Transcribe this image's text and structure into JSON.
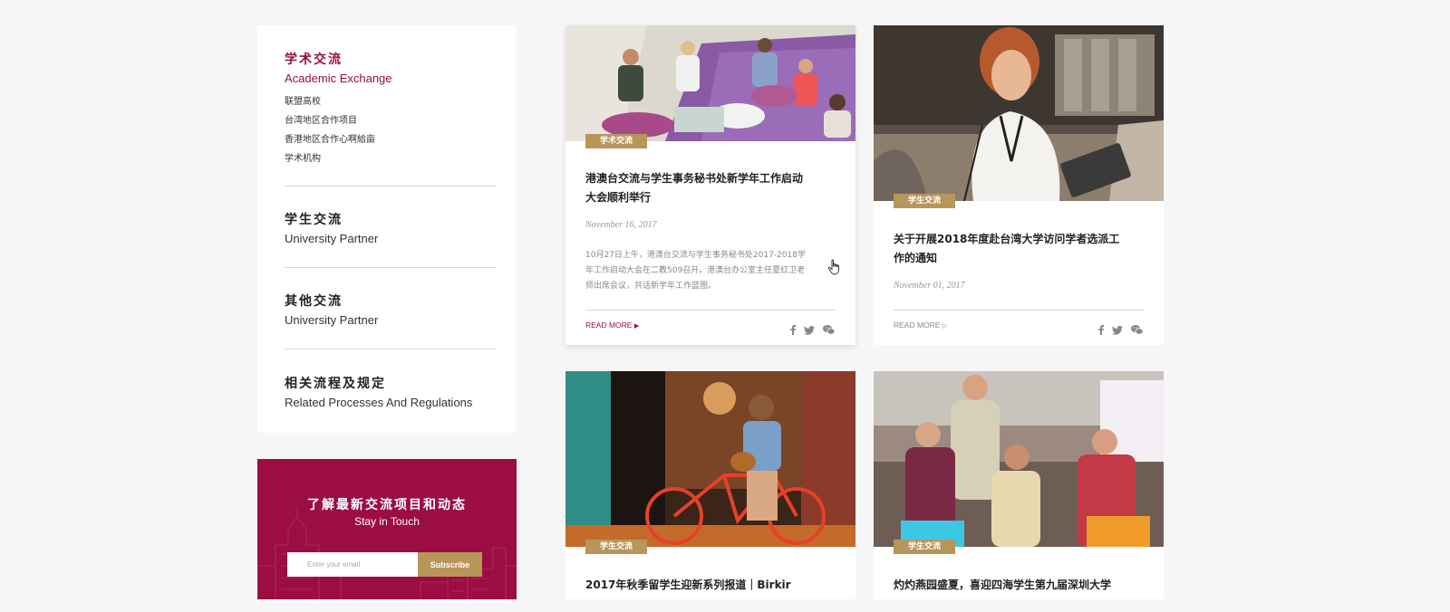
{
  "sidebar": {
    "academic": {
      "cn": "学术交流",
      "en": "Academic Exchange",
      "items": [
        "联盟高校",
        "台湾地区合作项目",
        "香港地区合作心啊給亩",
        "学术机构"
      ]
    },
    "student": {
      "cn": "学生交流",
      "en": "University Partner"
    },
    "other": {
      "cn": "其他交流",
      "en": "University Partner"
    },
    "rules": {
      "cn": "相关流程及规定",
      "en": "Related Processes And Regulations"
    }
  },
  "subscribe": {
    "title_cn": "了解最新交流项目和动态",
    "title_en": "Stay in Touch",
    "placeholder": "Enter your email",
    "button": "Subscribe"
  },
  "cards": [
    {
      "tag": "学术交流",
      "title": "港澳台交流与学生事务秘书处新学年工作启动大会顺利举行",
      "date": "November 16, 2017",
      "excerpt": "10月27日上午，港澳台交流与学生事务秘书处2017-2018学年工作启动大会在二教509召开。港澳台办公室主任夏红卫老师出席会议，共话新学年工作蓝图。",
      "read_more": "READ MORE"
    },
    {
      "tag": "学生交流",
      "title": "关于开展2018年度赴台湾大学访问学者选派工作的通知",
      "date": "November 01, 2017",
      "read_more": "READ MORE"
    },
    {
      "tag": "学生交流",
      "title": "2017年秋季留学生迎新系列报道｜Birkir"
    },
    {
      "tag": "学生交流",
      "title": "灼灼燕园盛夏，喜迎四海学生第九届深圳大学"
    }
  ],
  "colors": {
    "accent": "#9b0d43",
    "gold": "#b8955a",
    "background": "#f6f6f6"
  },
  "icons": [
    "facebook-icon",
    "twitter-icon",
    "wechat-icon",
    "hand-cursor-icon"
  ]
}
